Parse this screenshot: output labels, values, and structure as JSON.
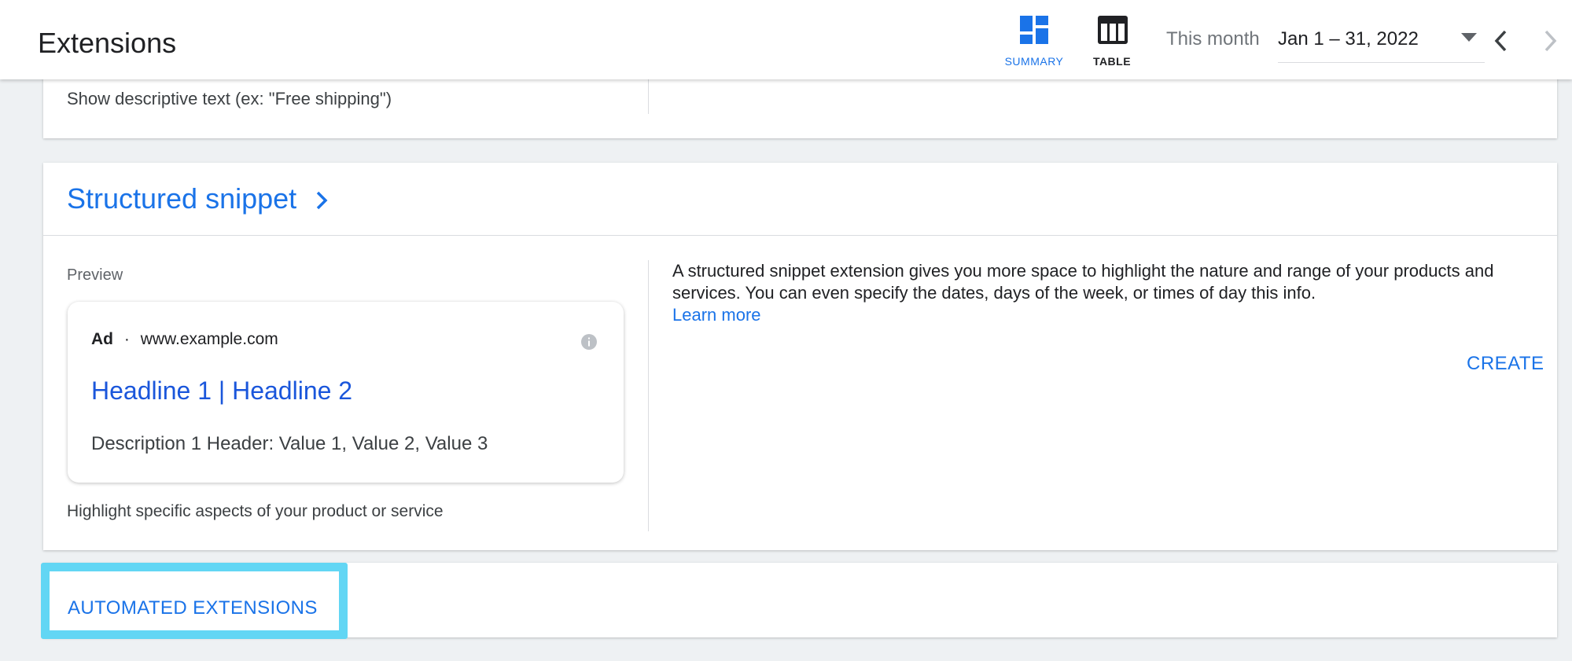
{
  "header": {
    "title": "Extensions",
    "view_summary_label": "SUMMARY",
    "view_table_label": "TABLE",
    "period_label": "This month",
    "date_range": "Jan 1 – 31, 2022"
  },
  "callout_card": {
    "description": "Show descriptive text (ex: \"Free shipping\")"
  },
  "structured_snippet": {
    "title": "Structured snippet",
    "preview_label": "Preview",
    "ad_preview": {
      "ad_badge": "Ad",
      "separator": "·",
      "url": "www.example.com",
      "headline": "Headline 1 | Headline 2",
      "description": "Description 1 Header: Value 1, Value 2, Value 3"
    },
    "highlight_text": "Highlight specific aspects of your product or service",
    "explanation": "A structured snippet extension gives you more space to highlight the nature and range of your products and services. You can even specify the dates, days of the week, or times of day this info.",
    "learn_more": "Learn more",
    "create_label": "CREATE"
  },
  "automated_extensions": {
    "label": "AUTOMATED EXTENSIONS"
  },
  "colors": {
    "accent": "#1a73e8",
    "highlight_border": "#62d6f4",
    "background": "#eef1f3"
  }
}
